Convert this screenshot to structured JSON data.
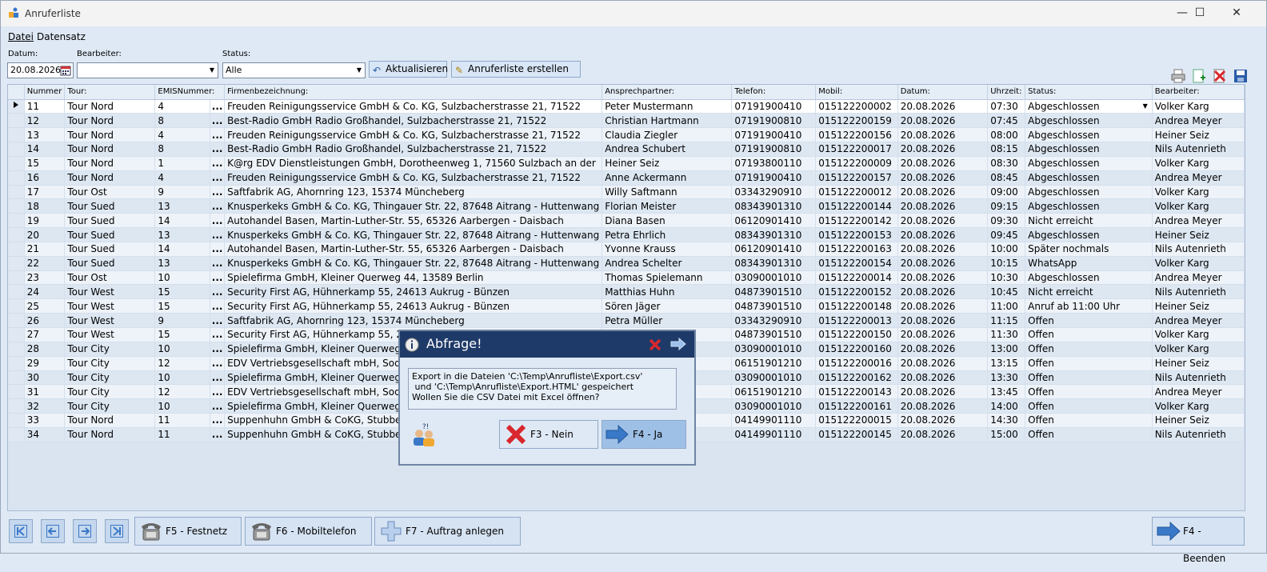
{
  "window": {
    "title": "Anruferliste",
    "minimize": "—",
    "maximize": "☐",
    "close": "✕"
  },
  "menu": {
    "datei": "Datei",
    "datensatz": "Datensatz"
  },
  "filters": {
    "datum_label": "Datum:",
    "datum_value": "20.08.2026",
    "bearbeiter_label": "Bearbeiter:",
    "bearbeiter_value": "",
    "status_label": "Status:",
    "status_value": "Alle",
    "aktualisieren": "Aktualisieren",
    "erstellen": "Anruferliste erstellen"
  },
  "grid": {
    "columns": [
      "Nummer",
      "Tour:",
      "EMISNummer:",
      "Firmenbezeichnung:",
      "Ansprechpartner:",
      "Telefon:",
      "Mobil:",
      "Datum:",
      "Uhrzeit:",
      "Status:",
      "Bearbeiter:"
    ],
    "rows": [
      [
        "11",
        "Tour Nord",
        "4",
        "Freuden Reinigungsservice GmbH & Co. KG, Sulzbacherstrasse 21, 71522",
        "Peter Mustermann",
        "07191900410",
        "015122200002",
        "20.08.2026",
        "07:30",
        "Abgeschlossen",
        "Volker Karg"
      ],
      [
        "12",
        "Tour Nord",
        "8",
        "Best-Radio GmbH Radio Großhandel, Sulzbacherstrasse 21, 71522",
        "Christian Hartmann",
        "07191900810",
        "015122200159",
        "20.08.2026",
        "07:45",
        "Abgeschlossen",
        "Andrea Meyer"
      ],
      [
        "13",
        "Tour Nord",
        "4",
        "Freuden Reinigungsservice GmbH & Co. KG, Sulzbacherstrasse 21, 71522",
        "Claudia Ziegler",
        "07191900410",
        "015122200156",
        "20.08.2026",
        "08:00",
        "Abgeschlossen",
        "Heiner Seiz"
      ],
      [
        "14",
        "Tour Nord",
        "8",
        "Best-Radio GmbH Radio Großhandel, Sulzbacherstrasse 21, 71522",
        "Andrea Schubert",
        "07191900810",
        "015122200017",
        "20.08.2026",
        "08:15",
        "Abgeschlossen",
        "Nils Autenrieth"
      ],
      [
        "15",
        "Tour Nord",
        "1",
        "K@rg EDV Dienstleistungen GmbH, Dorotheenweg 1, 71560 Sulzbach an der",
        "Heiner Seiz",
        "07193800110",
        "015122200009",
        "20.08.2026",
        "08:30",
        "Abgeschlossen",
        "Volker Karg"
      ],
      [
        "16",
        "Tour Nord",
        "4",
        "Freuden Reinigungsservice GmbH & Co. KG, Sulzbacherstrasse 21, 71522",
        "Anne Ackermann",
        "07191900410",
        "015122200157",
        "20.08.2026",
        "08:45",
        "Abgeschlossen",
        "Andrea Meyer"
      ],
      [
        "17",
        "Tour Ost",
        "9",
        "Saftfabrik AG, Ahornring 123, 15374 Müncheberg",
        "Willy Saftmann",
        "03343290910",
        "015122200012",
        "20.08.2026",
        "09:00",
        "Abgeschlossen",
        "Volker Karg"
      ],
      [
        "18",
        "Tour Sued",
        "13",
        "Knusperkeks GmbH & Co. KG, Thingauer Str. 22, 87648 Aitrang - Huttenwang",
        "Florian Meister",
        "08343901310",
        "015122200144",
        "20.08.2026",
        "09:15",
        "Abgeschlossen",
        "Volker Karg"
      ],
      [
        "19",
        "Tour Sued",
        "14",
        "Autohandel Basen, Martin-Luther-Str. 55, 65326 Aarbergen - Daisbach",
        "Diana Basen",
        "06120901410",
        "015122200142",
        "20.08.2026",
        "09:30",
        "Nicht erreicht",
        "Andrea Meyer"
      ],
      [
        "20",
        "Tour Sued",
        "13",
        "Knusperkeks GmbH & Co. KG, Thingauer Str. 22, 87648 Aitrang - Huttenwang",
        "Petra Ehrlich",
        "08343901310",
        "015122200153",
        "20.08.2026",
        "09:45",
        "Abgeschlossen",
        "Heiner Seiz"
      ],
      [
        "21",
        "Tour Sued",
        "14",
        "Autohandel Basen, Martin-Luther-Str. 55, 65326 Aarbergen - Daisbach",
        "Yvonne Krauss",
        "06120901410",
        "015122200163",
        "20.08.2026",
        "10:00",
        "Später nochmals",
        "Nils Autenrieth"
      ],
      [
        "22",
        "Tour Sued",
        "13",
        "Knusperkeks GmbH & Co. KG, Thingauer Str. 22, 87648 Aitrang - Huttenwang",
        "Andrea Schelter",
        "08343901310",
        "015122200154",
        "20.08.2026",
        "10:15",
        "WhatsApp",
        "Volker Karg"
      ],
      [
        "23",
        "Tour Ost",
        "10",
        "Spielefirma GmbH, Kleiner Querweg 44, 13589 Berlin",
        "Thomas Spielemann",
        "03090001010",
        "015122200014",
        "20.08.2026",
        "10:30",
        "Abgeschlossen",
        "Andrea Meyer"
      ],
      [
        "24",
        "Tour West",
        "15",
        "Security First AG, Hühnerkamp 55, 24613 Aukrug - Bünzen",
        "Matthias Huhn",
        "04873901510",
        "015122200152",
        "20.08.2026",
        "10:45",
        "Nicht erreicht",
        "Nils Autenrieth"
      ],
      [
        "25",
        "Tour West",
        "15",
        "Security First AG, Hühnerkamp 55, 24613 Aukrug - Bünzen",
        "Sören Jäger",
        "04873901510",
        "015122200148",
        "20.08.2026",
        "11:00",
        "Anruf ab 11:00 Uhr",
        "Heiner Seiz"
      ],
      [
        "26",
        "Tour West",
        "9",
        "Saftfabrik AG, Ahornring 123, 15374 Müncheberg",
        "Petra Müller",
        "03343290910",
        "015122200013",
        "20.08.2026",
        "11:15",
        "Offen",
        "Andrea Meyer"
      ],
      [
        "27",
        "Tour West",
        "15",
        "Security First AG, Hühnerkamp 55, 246",
        "",
        "04873901510",
        "015122200150",
        "20.08.2026",
        "11:30",
        "Offen",
        "Volker Karg"
      ],
      [
        "28",
        "Tour City",
        "10",
        "Spielefirma GmbH, Kleiner Querweg 44",
        "",
        "03090001010",
        "015122200160",
        "20.08.2026",
        "13:00",
        "Offen",
        "Volker Karg"
      ],
      [
        "29",
        "Tour City",
        "12",
        "EDV Vertriebsgesellschaft mbH, Soders",
        "",
        "06151901210",
        "015122200016",
        "20.08.2026",
        "13:15",
        "Offen",
        "Heiner Seiz"
      ],
      [
        "30",
        "Tour City",
        "10",
        "Spielefirma GmbH, Kleiner Querweg 44",
        "",
        "03090001010",
        "015122200162",
        "20.08.2026",
        "13:30",
        "Offen",
        "Nils Autenrieth"
      ],
      [
        "31",
        "Tour City",
        "12",
        "EDV Vertriebsgesellschaft mbH, Soders",
        "",
        "06151901210",
        "015122200143",
        "20.08.2026",
        "13:45",
        "Offen",
        "Andrea Meyer"
      ],
      [
        "32",
        "Tour City",
        "10",
        "Spielefirma GmbH, Kleiner Querweg 44",
        "",
        "03090001010",
        "015122200161",
        "20.08.2026",
        "14:00",
        "Offen",
        "Volker Karg"
      ],
      [
        "33",
        "Tour Nord",
        "11",
        "Suppenhuhn GmbH & CoKG, Stubbenka",
        "",
        "04149901110",
        "015122200015",
        "20.08.2026",
        "14:30",
        "Offen",
        "Heiner Seiz"
      ],
      [
        "34",
        "Tour Nord",
        "11",
        "Suppenhuhn GmbH & CoKG, Stubbenka",
        "",
        "04149901110",
        "015122200145",
        "20.08.2026",
        "15:00",
        "Offen",
        "Nils Autenrieth"
      ]
    ],
    "dots": "..."
  },
  "bottom": {
    "festnetz": "F5 - Festnetz",
    "mobil": "F6 - Mobiltelefon",
    "auftrag": "F7 - Auftrag anlegen",
    "beenden": "F4 - Beenden"
  },
  "dialog": {
    "title": "Abfrage!",
    "lines": [
      "Export in die Dateien 'C:\\Temp\\Anrufliste\\Export.csv'",
      " und 'C:\\Temp\\Anrufliste\\Export.HTML' gespeichert",
      "Wollen Sie die CSV Datei mit Excel öffnen?"
    ],
    "nein": "F3 - Nein",
    "ja": "F4 - Ja"
  },
  "colors": {
    "accent": "#1e3a68",
    "window_bg": "#dfe9f5",
    "button_bg": "#d6e3f3",
    "arrow_blue": "#3a78c8",
    "close_red": "#d8272e"
  }
}
